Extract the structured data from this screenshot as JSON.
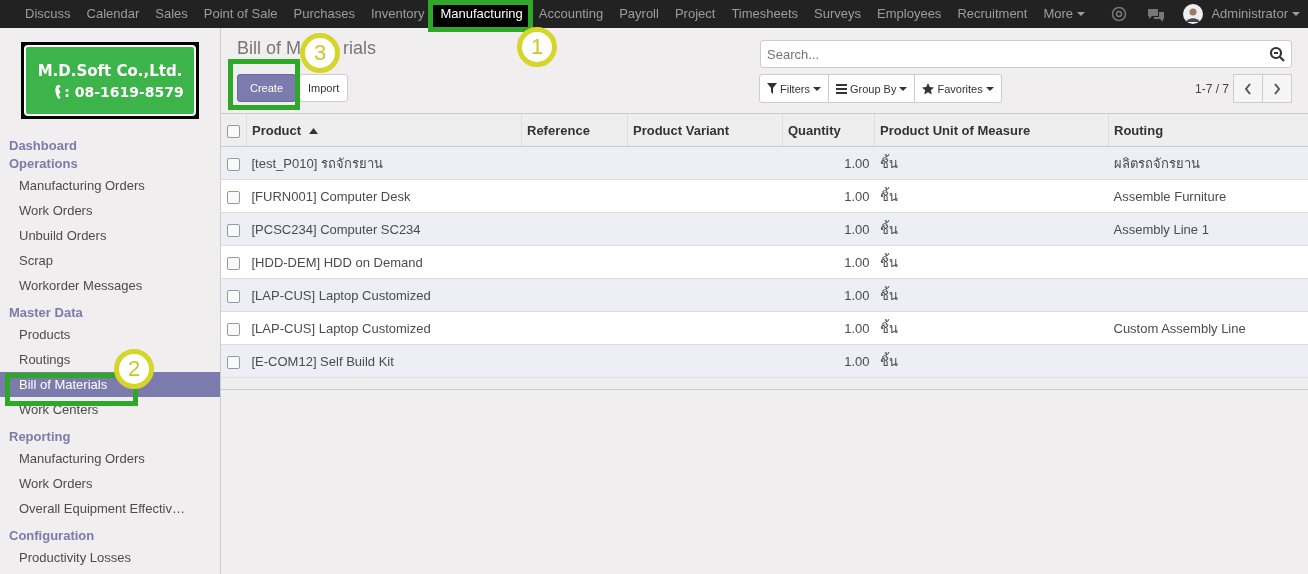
{
  "top_menu": [
    {
      "label": "Discuss",
      "selected": false
    },
    {
      "label": "Calendar",
      "selected": false
    },
    {
      "label": "Sales",
      "selected": false
    },
    {
      "label": "Point of Sale",
      "selected": false
    },
    {
      "label": "Purchases",
      "selected": false
    },
    {
      "label": "Inventory",
      "selected": false
    },
    {
      "label": "Manufacturing",
      "selected": true
    },
    {
      "label": "Accounting",
      "selected": false
    },
    {
      "label": "Payroll",
      "selected": false
    },
    {
      "label": "Project",
      "selected": false
    },
    {
      "label": "Timesheets",
      "selected": false
    },
    {
      "label": "Surveys",
      "selected": false
    },
    {
      "label": "Employees",
      "selected": false
    },
    {
      "label": "Recruitment",
      "selected": false
    }
  ],
  "more_label": "More",
  "user": "Administrator",
  "logo": {
    "company": "M.D.Soft Co.,Ltd.",
    "phone": ": 08-1619-8579"
  },
  "sidebar": [
    {
      "header": "Dashboard"
    },
    {
      "header": "Operations",
      "items": [
        {
          "label": "Manufacturing Orders",
          "selected": false
        },
        {
          "label": "Work Orders",
          "selected": false
        },
        {
          "label": "Unbuild Orders",
          "selected": false
        },
        {
          "label": "Scrap",
          "selected": false
        },
        {
          "label": "Workorder Messages",
          "selected": false
        }
      ]
    },
    {
      "header": "Master Data",
      "items": [
        {
          "label": "Products",
          "selected": false
        },
        {
          "label": "Routings",
          "selected": false
        },
        {
          "label": "Bill of Materials",
          "selected": true
        },
        {
          "label": "Work Centers",
          "selected": false
        }
      ]
    },
    {
      "header": "Reporting",
      "items": [
        {
          "label": "Manufacturing Orders",
          "selected": false
        },
        {
          "label": "Work Orders",
          "selected": false
        },
        {
          "label": "Overall Equipment Effectiv…",
          "selected": false
        }
      ]
    },
    {
      "header": "Configuration",
      "items": [
        {
          "label": "Productivity Losses",
          "selected": false
        }
      ]
    }
  ],
  "title": {
    "head": "Bill of M",
    "tail": "rials"
  },
  "buttons": {
    "create": "Create",
    "import": "Import"
  },
  "search": {
    "placeholder": "Search..."
  },
  "filters": [
    "Filters",
    "Group By",
    "Favorites"
  ],
  "pager": "1-7 / 7",
  "table": {
    "select_all_checked": false,
    "columns": [
      {
        "label": "Product",
        "sorted": true
      },
      {
        "label": "Reference",
        "sorted": false
      },
      {
        "label": "Product Variant",
        "sorted": false
      },
      {
        "label": "Quantity",
        "sorted": false
      },
      {
        "label": "Product Unit of Measure",
        "sorted": false
      },
      {
        "label": "Routing",
        "sorted": false
      }
    ],
    "rows": [
      {
        "product": "[test_P010] รถจักรยาน",
        "quantity": "1.00",
        "uom": "ชิ้น",
        "routing": "ผลิตรถจักรยาน",
        "checked": false
      },
      {
        "product": "[FURN001] Computer Desk",
        "quantity": "1.00",
        "uom": "ชิ้น",
        "routing": "Assemble Furniture",
        "checked": false
      },
      {
        "product": "[PCSC234] Computer SC234",
        "quantity": "1.00",
        "uom": "ชิ้น",
        "routing": "Assembly Line 1",
        "checked": false
      },
      {
        "product": "[HDD-DEM] HDD on Demand",
        "quantity": "1.00",
        "uom": "ชิ้น",
        "checked": false
      },
      {
        "product": "[LAP-CUS] Laptop Customized",
        "quantity": "1.00",
        "uom": "ชิ้น",
        "checked": false
      },
      {
        "product": "[LAP-CUS] Laptop Customized",
        "quantity": "1.00",
        "uom": "ชิ้น",
        "routing": "Custom Assembly Line",
        "checked": false
      },
      {
        "product": "[E-COM12] Self Build Kit",
        "quantity": "1.00",
        "uom": "ชิ้น",
        "checked": false
      }
    ]
  },
  "callouts": [
    {
      "number": "1"
    },
    {
      "number": "2"
    },
    {
      "number": "3"
    }
  ]
}
